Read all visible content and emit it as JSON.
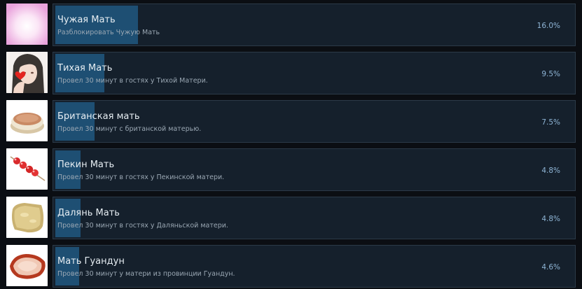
{
  "achievements": [
    {
      "title": "Чужая Мать",
      "description": "Разблокировать Чужую Мать",
      "percent_label": "16.0%",
      "percent": 16.0,
      "icon": "pink-glow-icon"
    },
    {
      "title": "Тихая Мать",
      "description": "Провел 30 минут в гостях у Тихой Матери.",
      "percent_label": "9.5%",
      "percent": 9.5,
      "icon": "woman-heart-portrait-icon"
    },
    {
      "title": "Британская мать",
      "description": "Провел 30 минут с британской матерью.",
      "percent_label": "7.5%",
      "percent": 7.5,
      "icon": "muffin-icon"
    },
    {
      "title": "Пекин Мать",
      "description": "Провел 30 минут в гостях у Пекинской матери.",
      "percent_label": "4.8%",
      "percent": 4.8,
      "icon": "candied-haws-skewer-icon"
    },
    {
      "title": "Далянь Мать",
      "description": "Провел 30 минут в гостях у Даляньской матери.",
      "percent_label": "4.8%",
      "percent": 4.8,
      "icon": "pastry-icon"
    },
    {
      "title": "Мать Гуандун",
      "description": "Провел 30 минут у матери из провинции Гуандун.",
      "percent_label": "4.6%",
      "percent": 4.6,
      "icon": "roast-meat-icon"
    }
  ],
  "colors": {
    "background": "#0b0e13",
    "panel": "#15202c",
    "progress_fill": "#1e4f73",
    "percent_text": "#8fb5d6"
  }
}
